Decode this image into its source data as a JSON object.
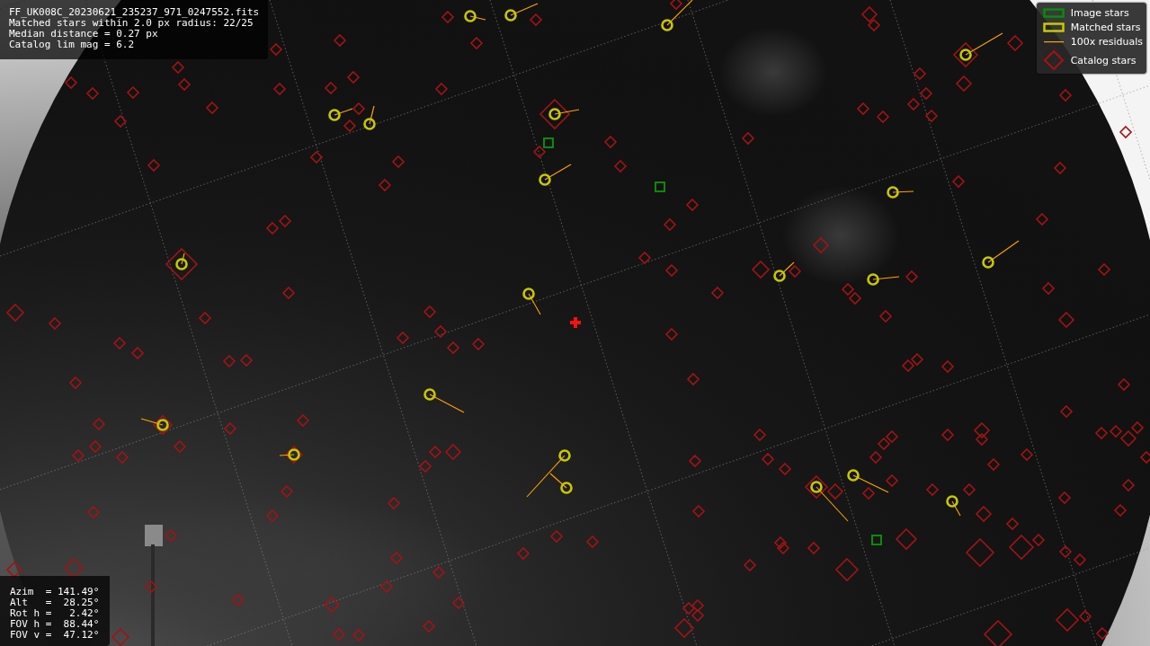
{
  "file_info": {
    "lines": [
      "FF_UK008C_20230621_235237_971_0247552.fits",
      "Matched stars within 2.0 px radius: 22/25",
      "Median distance = 0.27 px",
      "Catalog lim mag = 6.2"
    ]
  },
  "legend": [
    {
      "label": "Image stars"
    },
    {
      "kind": "matched",
      "label": "Matched stars"
    },
    {
      "kind": "residual",
      "label": "100x residuals"
    },
    {
      "kind": "catalog",
      "label": "Catalog stars"
    }
  ],
  "pointing": {
    "lines": [
      "Azim  = 141.49°",
      "Alt   =  28.25°",
      "Rot h =   2.42°",
      "FOV h =  88.44°",
      "FOV v =  47.12°"
    ]
  }
}
